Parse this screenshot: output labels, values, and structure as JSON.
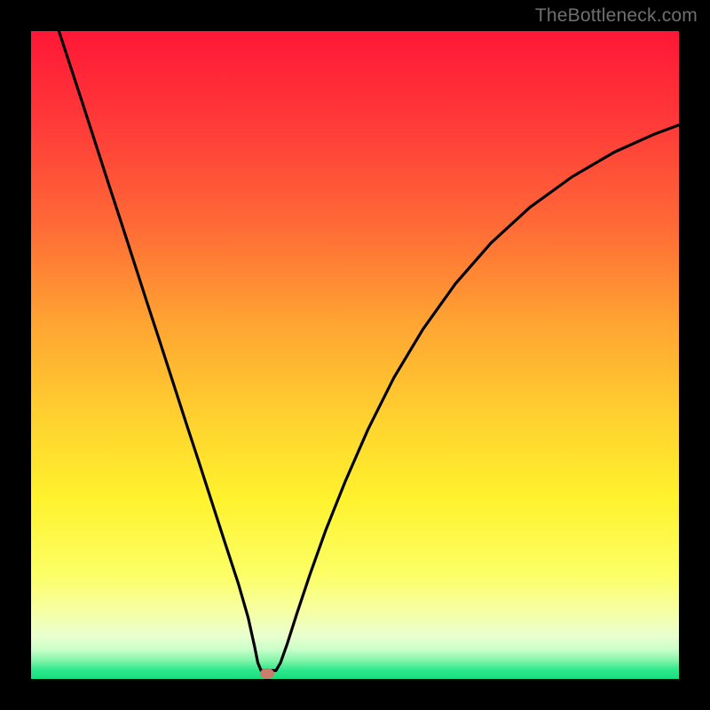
{
  "watermark": "TheBottleneck.com",
  "marker": {
    "x_frac": 0.365,
    "y_frac": 0.992,
    "color": "#cb7d6c"
  },
  "chart_data": {
    "type": "line",
    "title": "",
    "xlabel": "",
    "ylabel": "",
    "xlim": [
      0,
      1
    ],
    "ylim": [
      0,
      100
    ],
    "curve": {
      "name": "bottleneck-curve",
      "points": [
        {
          "x": 0.043,
          "y": 100.0
        },
        {
          "x": 0.06,
          "y": 94.8
        },
        {
          "x": 0.08,
          "y": 88.7
        },
        {
          "x": 0.1,
          "y": 82.5
        },
        {
          "x": 0.12,
          "y": 76.3
        },
        {
          "x": 0.14,
          "y": 70.2
        },
        {
          "x": 0.16,
          "y": 64.0
        },
        {
          "x": 0.18,
          "y": 57.8
        },
        {
          "x": 0.2,
          "y": 51.7
        },
        {
          "x": 0.22,
          "y": 45.5
        },
        {
          "x": 0.24,
          "y": 39.3
        },
        {
          "x": 0.26,
          "y": 33.2
        },
        {
          "x": 0.28,
          "y": 27.0
        },
        {
          "x": 0.3,
          "y": 20.8
        },
        {
          "x": 0.32,
          "y": 14.7
        },
        {
          "x": 0.335,
          "y": 9.5
        },
        {
          "x": 0.345,
          "y": 5.0
        },
        {
          "x": 0.35,
          "y": 2.5
        },
        {
          "x": 0.355,
          "y": 1.3
        },
        {
          "x": 0.365,
          "y": 1.3
        },
        {
          "x": 0.378,
          "y": 1.3
        },
        {
          "x": 0.385,
          "y": 2.5
        },
        {
          "x": 0.395,
          "y": 5.3
        },
        {
          "x": 0.41,
          "y": 10.0
        },
        {
          "x": 0.43,
          "y": 16.0
        },
        {
          "x": 0.455,
          "y": 23.0
        },
        {
          "x": 0.485,
          "y": 30.5
        },
        {
          "x": 0.52,
          "y": 38.5
        },
        {
          "x": 0.56,
          "y": 46.5
        },
        {
          "x": 0.605,
          "y": 54.0
        },
        {
          "x": 0.655,
          "y": 61.0
        },
        {
          "x": 0.71,
          "y": 67.3
        },
        {
          "x": 0.77,
          "y": 72.8
        },
        {
          "x": 0.835,
          "y": 77.5
        },
        {
          "x": 0.9,
          "y": 81.3
        },
        {
          "x": 0.96,
          "y": 84.0
        },
        {
          "x": 1.0,
          "y": 85.5
        }
      ]
    },
    "gradient_stops": [
      {
        "pos": 0.0,
        "color": "#ff1736"
      },
      {
        "pos": 0.15,
        "color": "#ff3c39"
      },
      {
        "pos": 0.3,
        "color": "#ff6a36"
      },
      {
        "pos": 0.45,
        "color": "#ffa432"
      },
      {
        "pos": 0.6,
        "color": "#ffd22f"
      },
      {
        "pos": 0.72,
        "color": "#fff22d"
      },
      {
        "pos": 0.84,
        "color": "#fcff66"
      },
      {
        "pos": 0.9,
        "color": "#f6ffa8"
      },
      {
        "pos": 0.935,
        "color": "#e8ffd0"
      },
      {
        "pos": 0.955,
        "color": "#c8ffc8"
      },
      {
        "pos": 0.972,
        "color": "#80f5a8"
      },
      {
        "pos": 0.986,
        "color": "#2ee88c"
      },
      {
        "pos": 1.0,
        "color": "#16df7e"
      }
    ]
  }
}
